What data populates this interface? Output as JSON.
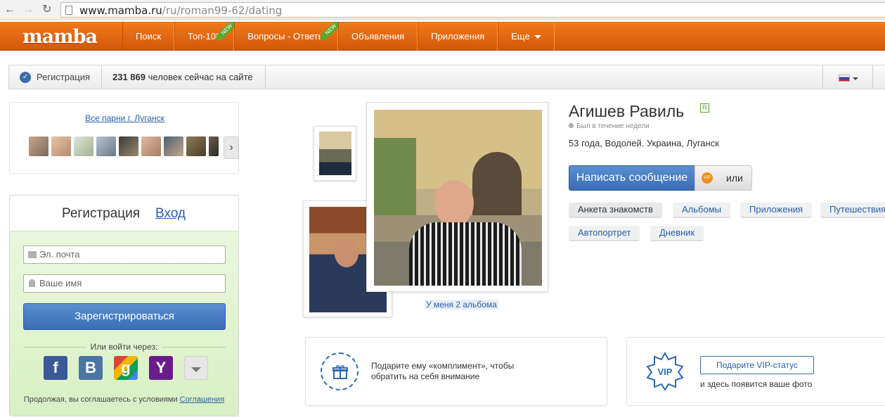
{
  "browser": {
    "url_host": "www.mamba.ru",
    "url_path": "/ru/roman99-62/dating"
  },
  "header": {
    "logo": "mamba",
    "menu": [
      {
        "label": "Поиск"
      },
      {
        "label": "Топ-100",
        "badge": "NEW"
      },
      {
        "label": "Вопросы - Ответы",
        "badge": "NEW"
      },
      {
        "label": "Объявления"
      },
      {
        "label": "Приложения"
      },
      {
        "label": "Еще"
      }
    ]
  },
  "infobar": {
    "register_label": "Регистрация",
    "online_count": "231 869",
    "online_text": "человек сейчас на сайте"
  },
  "guys": {
    "link_label": "Все парни г. Луганск",
    "thumb_count_visible": 9
  },
  "registration": {
    "tab_register": "Регистрация",
    "tab_login": "Вход",
    "email_placeholder": "Эл. почта",
    "name_placeholder": "Ваше имя",
    "submit_label": "Зарегистрироваться",
    "or_login_via": "Или войти через:",
    "socials": [
      "f",
      "B",
      "g",
      "Y"
    ],
    "terms_text": "Продолжая, вы соглашаетесь с условиями",
    "terms_link": "Соглашения"
  },
  "profile": {
    "name": "Агишев Равиль",
    "real_badge": "R",
    "last_seen": "Был в течение недели",
    "details": "53 года, Водолей. Украина, Луганск",
    "message_button": "Написать сообщение",
    "vip_mini": "VIP",
    "or_label": "или",
    "albums_link": "У меня 2 альбома",
    "tabs": [
      {
        "label": "Анкета знакомств",
        "active": true
      },
      {
        "label": "Альбомы"
      },
      {
        "label": "Приложения"
      },
      {
        "label": "Путешествия"
      },
      {
        "label": "Автопортрет"
      },
      {
        "label": "Дневник"
      }
    ]
  },
  "gift": {
    "text": "Подарите ему «комплимент», чтобы обратить на себя внимание"
  },
  "vip": {
    "button_label": "Подарите VIP-статус",
    "note": "и здесь появится ваше фото",
    "star_label": "VIP"
  },
  "colors": {
    "header_orange": "#e86a14",
    "link_blue": "#2c5ea8",
    "button_blue": "#4a7ec2",
    "reg_green": "#d8f0c4"
  }
}
